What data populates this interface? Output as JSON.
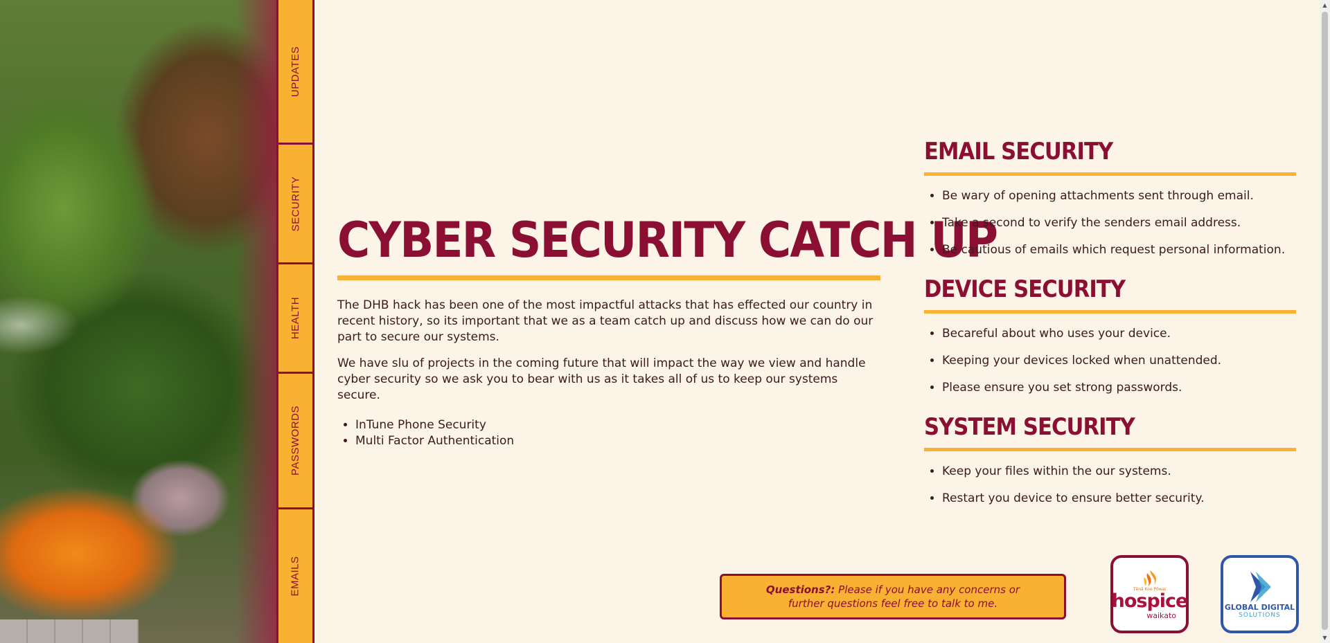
{
  "nav": {
    "items": [
      {
        "label": "UPDATES"
      },
      {
        "label": "SECURITY"
      },
      {
        "label": "HEALTH"
      },
      {
        "label": "PASSWORDS"
      },
      {
        "label": "EMAILS"
      }
    ]
  },
  "main": {
    "title": "CYBER SECURITY CATCH UP",
    "paragraphs": [
      "The DHB hack has been one of the most impactful attacks that has effected our country in recent history, so its important that we as a team catch up and discuss how we can do our part to secure our systems.",
      "We have slu of projects in the coming future that will impact the way we view and handle cyber security so we ask you to bear with us as it takes all of us to keep our systems secure."
    ],
    "projects": [
      "InTune Phone Security",
      "Multi Factor Authentication"
    ]
  },
  "sections": [
    {
      "heading": "EMAIL SECURITY",
      "items": [
        "Be wary of opening attachments sent through email.",
        "Take a second to verify the senders email address.",
        "Be cautious of emails which request personal information."
      ]
    },
    {
      "heading": "DEVICE SECURITY",
      "items": [
        "Becareful about who uses your device.",
        "Keeping your devices locked when unattended.",
        "Please ensure you set strong passwords."
      ]
    },
    {
      "heading": "SYSTEM SECURITY",
      "items": [
        "Keep your files within the our systems.",
        "Restart you device to ensure better security."
      ]
    }
  ],
  "questions": {
    "label": "Questions?:",
    "text": "Please if you have any concerns or further questions feel free to talk to me."
  },
  "logos": {
    "hospice": {
      "tag": "Tēnā Koe Pōwai",
      "name": "hospice",
      "sub": "waikato"
    },
    "gds": {
      "name": "GLOBAL DIGITAL",
      "sub": "SOLUTIONS"
    }
  },
  "colors": {
    "brand": "#8a0f32",
    "accent": "#f8b133",
    "background": "#fdf4e8"
  }
}
